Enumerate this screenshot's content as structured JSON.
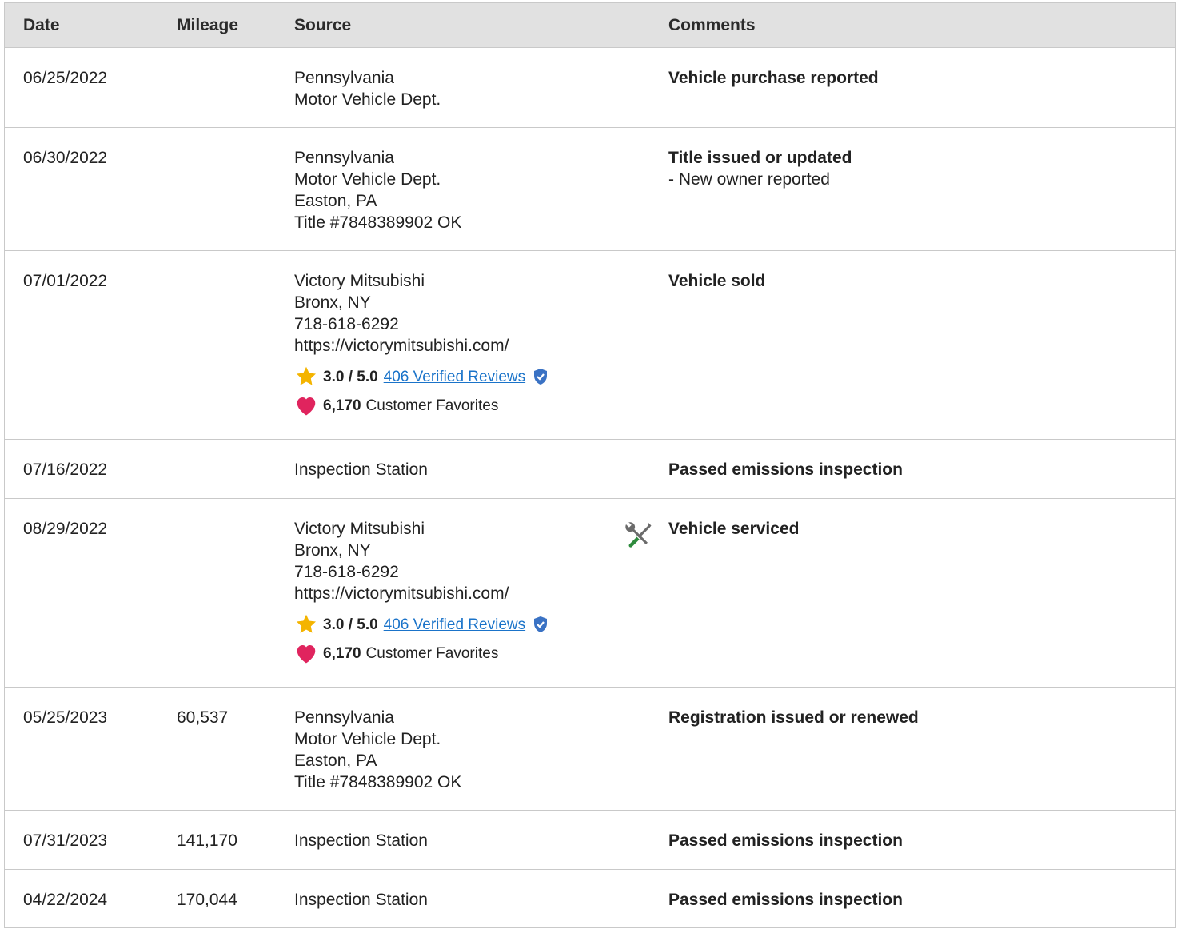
{
  "headers": {
    "date": "Date",
    "mileage": "Mileage",
    "source": "Source",
    "comments": "Comments"
  },
  "colors": {
    "header_bg": "#e1e1e1",
    "link": "#1a73c9",
    "star": "#f4b400",
    "heart": "#e0245e",
    "verified": "#3a72c4",
    "service_icon_handle": "#2e8b3d"
  },
  "rows": [
    {
      "date": "06/25/2022",
      "mileage": "",
      "source": [
        "Pennsylvania",
        "Motor Vehicle Dept."
      ],
      "comment_title": "Vehicle purchase reported",
      "comment_note": ""
    },
    {
      "date": "06/30/2022",
      "mileage": "",
      "source": [
        "Pennsylvania",
        "Motor Vehicle Dept.",
        "Easton, PA",
        "Title #7848389902 OK"
      ],
      "comment_title": "Title issued or updated",
      "comment_note": "- New owner reported"
    },
    {
      "date": "07/01/2022",
      "mileage": "",
      "source": [
        "Victory Mitsubishi",
        "Bronx, NY",
        "718-618-6292",
        "https://victorymitsubishi.com/"
      ],
      "rating": "3.0 / 5.0",
      "reviews_link": "406 Verified Reviews",
      "favorites_count": "6,170",
      "favorites_label": "Customer Favorites",
      "comment_title": "Vehicle sold",
      "comment_note": ""
    },
    {
      "date": "07/16/2022",
      "mileage": "",
      "source": [
        "Inspection Station"
      ],
      "comment_title": "Passed emissions inspection",
      "comment_note": ""
    },
    {
      "date": "08/29/2022",
      "mileage": "",
      "source": [
        "Victory Mitsubishi",
        "Bronx, NY",
        "718-618-6292",
        "https://victorymitsubishi.com/"
      ],
      "rating": "3.0 / 5.0",
      "reviews_link": "406 Verified Reviews",
      "favorites_count": "6,170",
      "favorites_label": "Customer Favorites",
      "icon": "service-tools-icon",
      "comment_title": "Vehicle serviced",
      "comment_note": ""
    },
    {
      "date": "05/25/2023",
      "mileage": "60,537",
      "source": [
        "Pennsylvania",
        "Motor Vehicle Dept.",
        "Easton, PA",
        "Title #7848389902 OK"
      ],
      "comment_title": "Registration issued or renewed",
      "comment_note": ""
    },
    {
      "date": "07/31/2023",
      "mileage": "141,170",
      "source": [
        "Inspection Station"
      ],
      "comment_title": "Passed emissions inspection",
      "comment_note": ""
    },
    {
      "date": "04/22/2024",
      "mileage": "170,044",
      "source": [
        "Inspection Station"
      ],
      "comment_title": "Passed emissions inspection",
      "comment_note": ""
    }
  ]
}
